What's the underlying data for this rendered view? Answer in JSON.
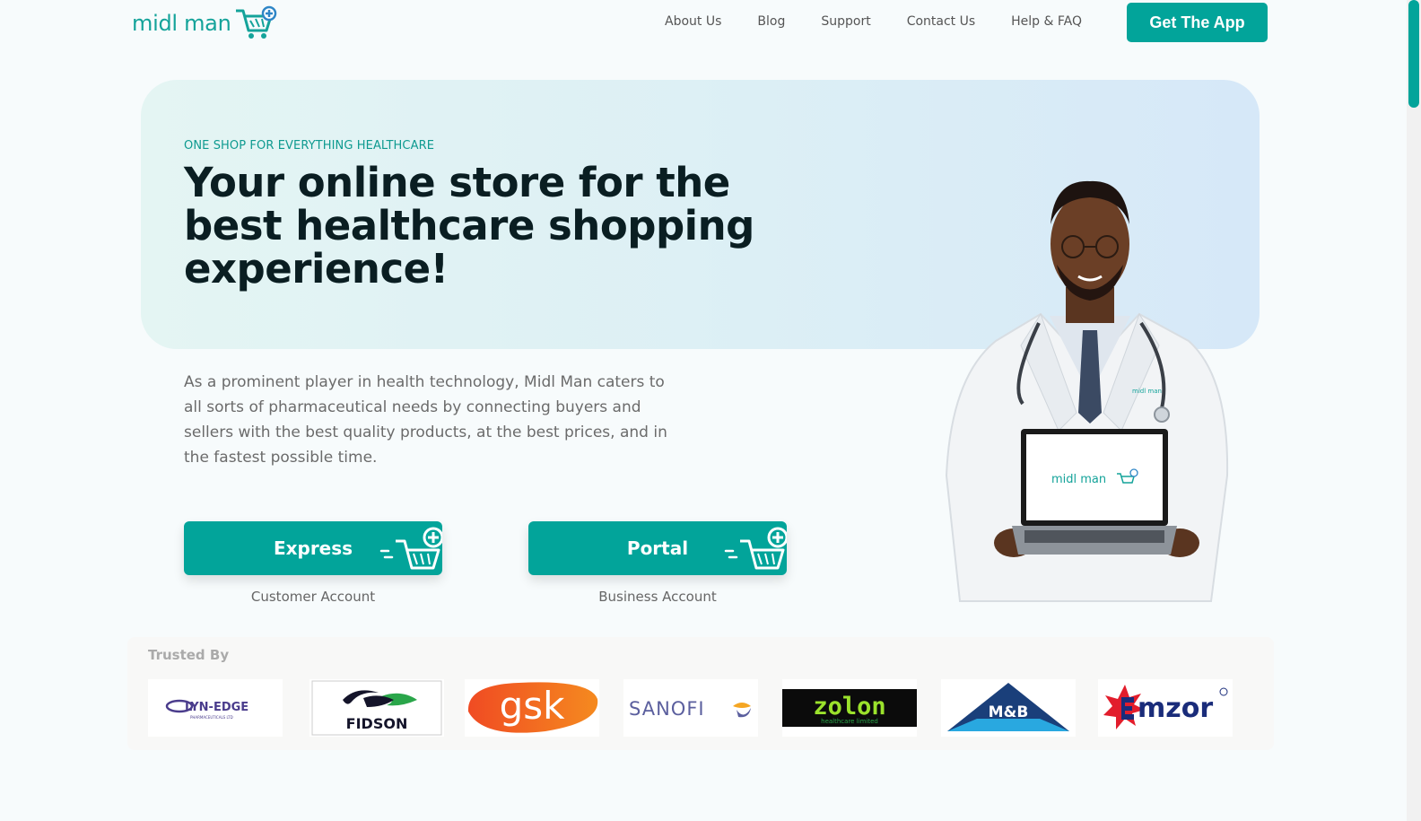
{
  "header": {
    "logo_text": "midl man",
    "nav": [
      "About Us",
      "Blog",
      "Support",
      "Contact Us",
      "Help & FAQ"
    ],
    "cta_label": "Get The App"
  },
  "hero": {
    "eyebrow": "ONE SHOP FOR EVERYTHING HEALTHCARE",
    "headline": "Your online store for the best healthcare shopping experience!",
    "description": "As a prominent player in health technology, Midl Man caters to all sorts of pharmaceutical needs by connecting buyers and sellers with the best quality products, at the best prices, and in the fastest possible time.",
    "laptop_logo_text": "midl man",
    "coat_badge_text": "midl man"
  },
  "ctas": [
    {
      "label": "Express",
      "sub": "Customer Account"
    },
    {
      "label": "Portal",
      "sub": "Business Account"
    }
  ],
  "trusted": {
    "title": "Trusted By",
    "partners": [
      {
        "name": "LYN-EDGE",
        "subtext": "PHARMACEUTICALS LTD"
      },
      {
        "name": "FIDSON"
      },
      {
        "name": "gsk"
      },
      {
        "name": "SANOFI"
      },
      {
        "name": "zolon",
        "subtext": "healthcare limited"
      },
      {
        "name": "M&B"
      },
      {
        "name": "mzor"
      }
    ]
  },
  "colors": {
    "brand_teal": "#02a49a",
    "headline": "#0a1e22",
    "body_text": "#6b6b6b"
  },
  "icons": [
    "cart-plus-icon"
  ]
}
